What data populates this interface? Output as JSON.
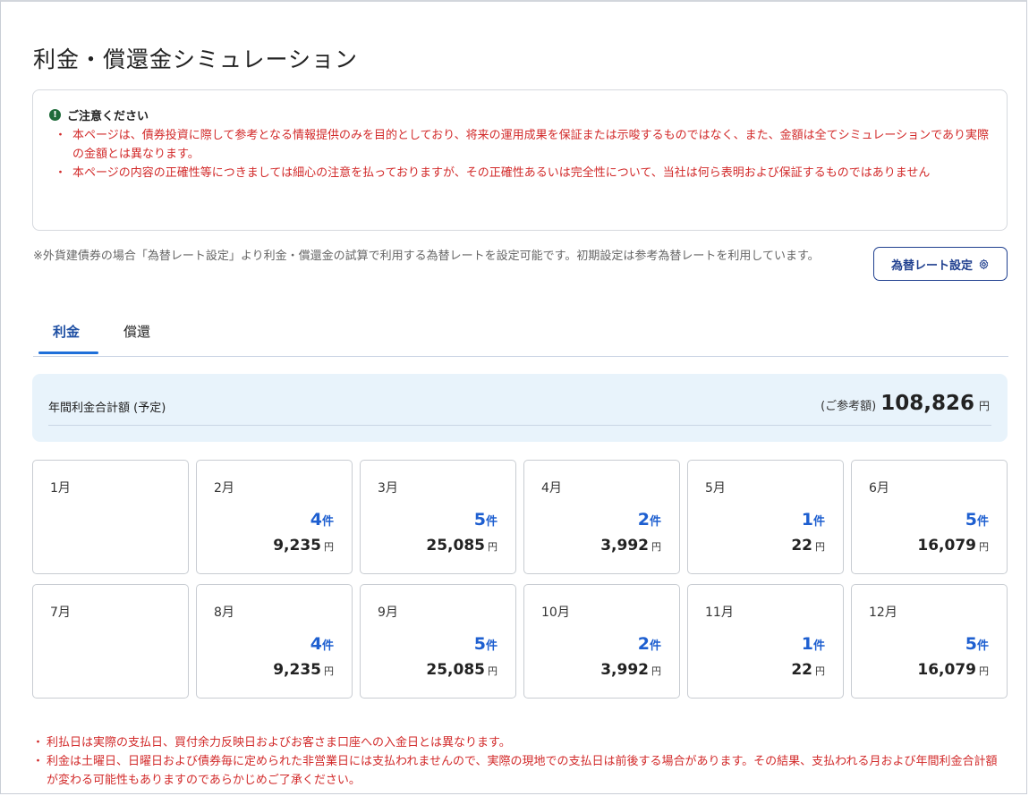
{
  "page": {
    "title": "利金・償還金シミュレーション"
  },
  "notice": {
    "icon": "exclamation-icon",
    "title": "ご注意ください",
    "items": [
      "本ページは、債券投資に際して参考となる情報提供のみを目的としており、将来の運用成果を保証または示唆するものではなく、また、金額は全てシミュレーションであり実際の金額とは異なります。",
      "本ページの内容の正確性等につきましては細心の注意を払っておりますが、その正確性あるいは完全性について、当社は何ら表明および保証するものではありません"
    ]
  },
  "fx": {
    "note": "※外貨建債券の場合「為替レート設定」より利金・償還金の試算で利用する為替レートを設定可能です。初期設定は参考為替レートを利用しています。",
    "button_label": "為替レート設定",
    "button_icon": "gear-icon"
  },
  "tabs": [
    {
      "label": "利金",
      "active": true
    },
    {
      "label": "償還",
      "active": false
    }
  ],
  "summary": {
    "label": "年間利金合計額 (予定)",
    "prefix": "(ご参考額)",
    "amount": "108,826",
    "unit": "円"
  },
  "months": [
    {
      "label": "1月",
      "count": "",
      "count_unit": "",
      "amount": "",
      "amount_unit": ""
    },
    {
      "label": "2月",
      "count": "4",
      "count_unit": "件",
      "amount": "9,235",
      "amount_unit": "円"
    },
    {
      "label": "3月",
      "count": "5",
      "count_unit": "件",
      "amount": "25,085",
      "amount_unit": "円"
    },
    {
      "label": "4月",
      "count": "2",
      "count_unit": "件",
      "amount": "3,992",
      "amount_unit": "円"
    },
    {
      "label": "5月",
      "count": "1",
      "count_unit": "件",
      "amount": "22",
      "amount_unit": "円"
    },
    {
      "label": "6月",
      "count": "5",
      "count_unit": "件",
      "amount": "16,079",
      "amount_unit": "円"
    },
    {
      "label": "7月",
      "count": "",
      "count_unit": "",
      "amount": "",
      "amount_unit": ""
    },
    {
      "label": "8月",
      "count": "4",
      "count_unit": "件",
      "amount": "9,235",
      "amount_unit": "円"
    },
    {
      "label": "9月",
      "count": "5",
      "count_unit": "件",
      "amount": "25,085",
      "amount_unit": "円"
    },
    {
      "label": "10月",
      "count": "2",
      "count_unit": "件",
      "amount": "3,992",
      "amount_unit": "円"
    },
    {
      "label": "11月",
      "count": "1",
      "count_unit": "件",
      "amount": "22",
      "amount_unit": "円"
    },
    {
      "label": "12月",
      "count": "5",
      "count_unit": "件",
      "amount": "16,079",
      "amount_unit": "円"
    }
  ],
  "footnotes": [
    "利払日は実際の支払日、買付余力反映日およびお客さま口座への入金日とは異なります。",
    "利金は土曜日、日曜日および債券毎に定められた非営業日には支払われませんので、実際の現地での支払日は前後する場合があります。その結果、支払われる月および年間利金合計額が変わる可能性もありますのであらかじめご了承ください。"
  ],
  "colors": {
    "accent": "#1e4fa3",
    "warning": "#d22a2a",
    "count": "#1e5fd0",
    "summary_bg": "#e8f3fb"
  }
}
